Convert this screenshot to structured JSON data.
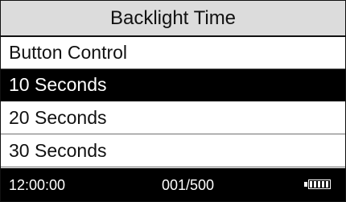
{
  "title": "Backlight Time",
  "menu": {
    "items": [
      {
        "label": "Button Control",
        "selected": false
      },
      {
        "label": "10 Seconds",
        "selected": true
      },
      {
        "label": "20 Seconds",
        "selected": false
      },
      {
        "label": "30 Seconds",
        "selected": false
      }
    ]
  },
  "status": {
    "time": "12:00:00",
    "counter": "001/500",
    "battery": {
      "icon": "battery-icon",
      "level": 1
    }
  },
  "colors": {
    "title_background": "#dcdcdc",
    "selected_background": "#000000",
    "status_background": "#000000",
    "text": "#111111",
    "selected_text": "#ffffff"
  }
}
